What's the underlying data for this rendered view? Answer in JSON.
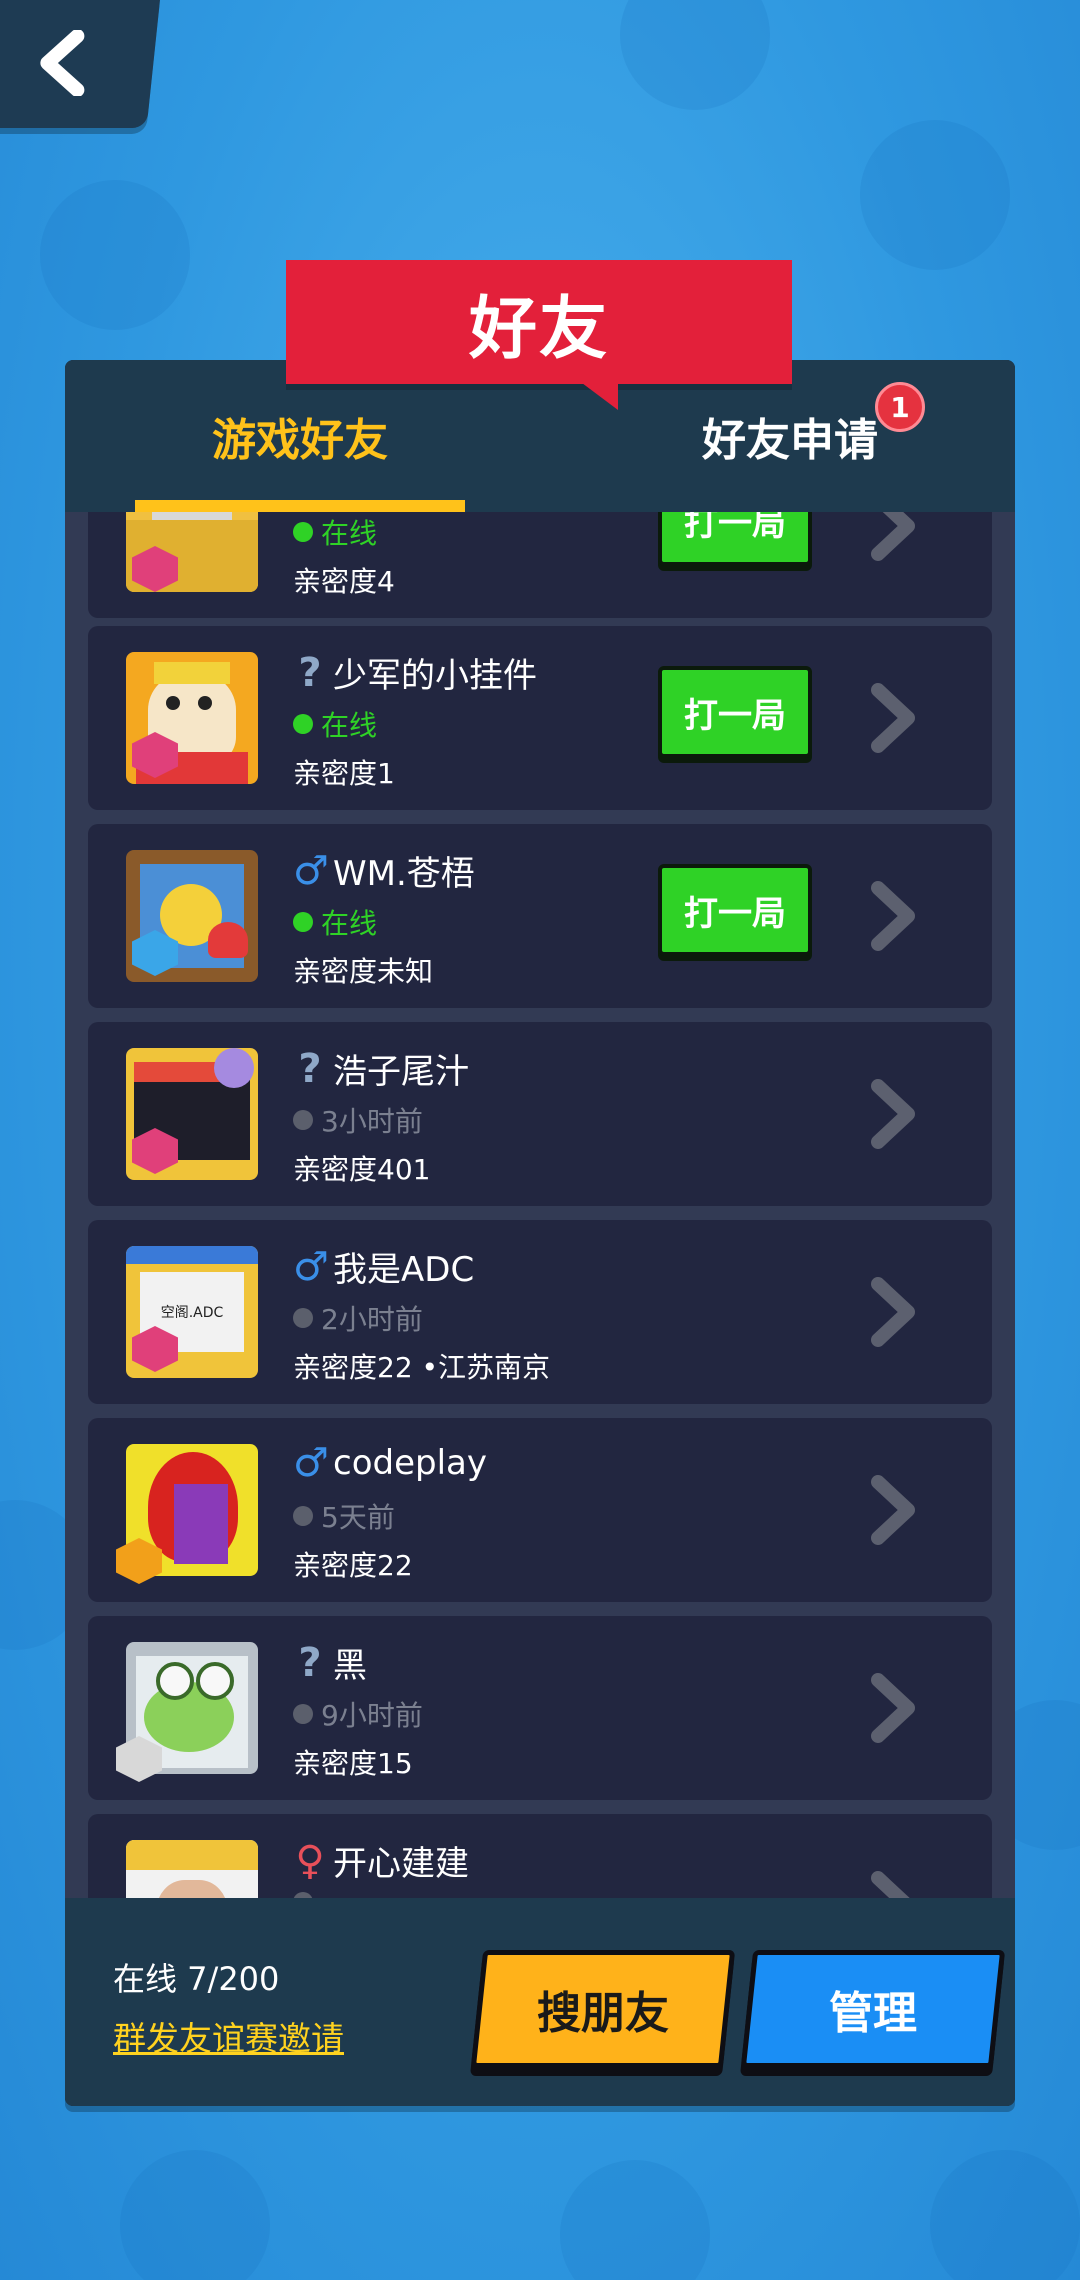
{
  "title": "好友",
  "tabs": [
    {
      "label": "游戏好友",
      "active": true
    },
    {
      "label": "好友申请",
      "badge": "1"
    }
  ],
  "friends": [
    {
      "gender": "?",
      "gender_color": "#8fa8c8",
      "name": "",
      "status": "在线",
      "online": true,
      "intimacy": "亲密度4",
      "play_label": "打一局"
    },
    {
      "gender": "?",
      "gender_color": "#8fa8c8",
      "name": "少军的小挂件",
      "status": "在线",
      "online": true,
      "intimacy": "亲密度1",
      "play_label": "打一局"
    },
    {
      "gender": "♂",
      "gender_color": "#3a8fe8",
      "name": "WM.苍梧",
      "status": "在线",
      "online": true,
      "intimacy": "亲密度未知",
      "play_label": "打一局"
    },
    {
      "gender": "?",
      "gender_color": "#8fa8c8",
      "name": "浩子尾汁",
      "status": "3小时前",
      "online": false,
      "intimacy": "亲密度401"
    },
    {
      "gender": "♂",
      "gender_color": "#3a8fe8",
      "name": "我是ADC",
      "status": "2小时前",
      "online": false,
      "intimacy": "亲密度22 •江苏南京",
      "avatar_text": "空阁.ADC"
    },
    {
      "gender": "♂",
      "gender_color": "#3a8fe8",
      "name": "codeplay",
      "status": "5天前",
      "online": false,
      "intimacy": "亲密度22"
    },
    {
      "gender": "?",
      "gender_color": "#8fa8c8",
      "name": "黑",
      "status": "9小时前",
      "online": false,
      "intimacy": "亲密度15"
    },
    {
      "gender": "♀",
      "gender_color": "#e8505a",
      "name": "开心建建",
      "status": "",
      "online": false,
      "intimacy": ""
    }
  ],
  "footer": {
    "online_count": "在线 7/200",
    "invite_link": "群发友谊赛邀请",
    "search_button": "搜朋友",
    "manage_button": "管理"
  },
  "colors": {
    "online_green": "#2fd226",
    "offline_gray": "#5b5f6c",
    "accent_yellow": "#ffc21a",
    "banner_red": "#e3203a"
  }
}
